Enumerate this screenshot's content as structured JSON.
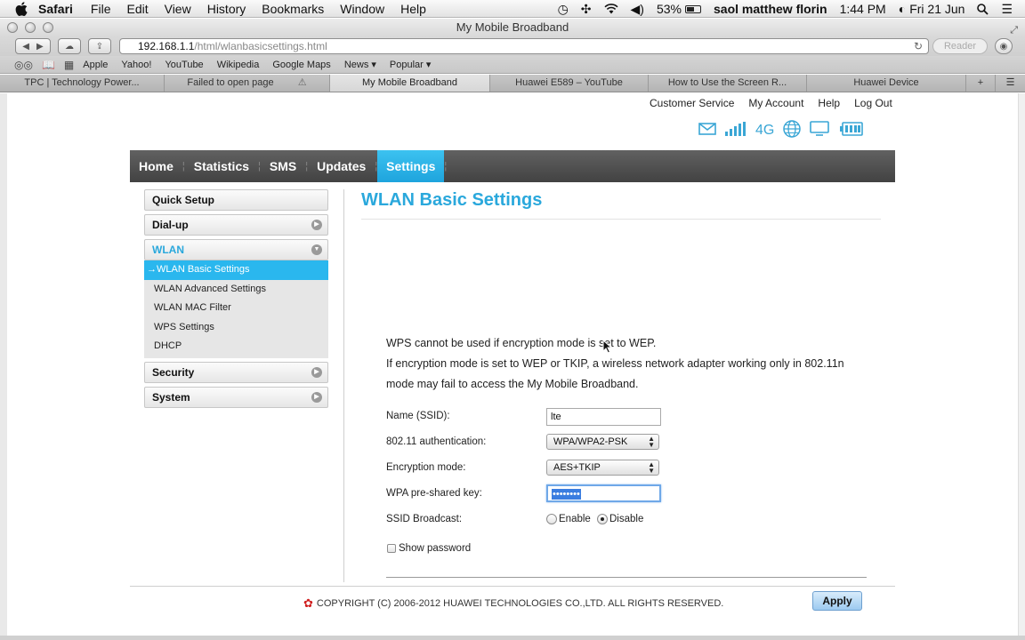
{
  "menubar": {
    "app": "Safari",
    "items": [
      "File",
      "Edit",
      "View",
      "History",
      "Bookmarks",
      "Window",
      "Help"
    ],
    "battery": "53%",
    "user": "saol matthew florin",
    "time": "1:44 PM",
    "date": "Fri 21 Jun"
  },
  "window": {
    "title": "My Mobile Broadband"
  },
  "toolbar": {
    "url_host": "192.168.1.1",
    "url_path": "/html/wlanbasicsettings.html",
    "reader": "Reader"
  },
  "bookmarks": [
    "Apple",
    "Yahoo!",
    "YouTube",
    "Wikipedia",
    "Google Maps",
    "News ▾",
    "Popular ▾"
  ],
  "tabs": [
    {
      "label": "TPC | Technology Power..."
    },
    {
      "label": "Failed to open page"
    },
    {
      "label": "My Mobile Broadband"
    },
    {
      "label": "Huawei E589 – YouTube"
    },
    {
      "label": "How to Use the Screen R..."
    },
    {
      "label": "Huawei Device"
    }
  ],
  "top_links": [
    "Customer Service",
    "My Account",
    "Help",
    "Log Out"
  ],
  "network_type": "4G",
  "nav": [
    "Home",
    "Statistics",
    "SMS",
    "Updates",
    "Settings"
  ],
  "sidebar": {
    "quick_setup": "Quick Setup",
    "dialup": "Dial-up",
    "wlan": "WLAN",
    "wlan_items": [
      "→WLAN Basic Settings",
      "WLAN Advanced Settings",
      "WLAN MAC Filter",
      "WPS Settings",
      "DHCP"
    ],
    "security": "Security",
    "system": "System"
  },
  "main": {
    "title": "WLAN Basic Settings",
    "info1": "WPS cannot be used if encryption mode is set to WEP.",
    "info2": "If encryption mode is set to WEP or TKIP, a wireless network adapter working only in 802.11n",
    "info3": "mode may fail to access the My Mobile Broadband.",
    "ssid_label": "Name (SSID):",
    "ssid_value": "lte",
    "auth_label": "802.11 authentication:",
    "auth_value": "WPA/WPA2-PSK",
    "enc_label": "Encryption mode:",
    "enc_value": "AES+TKIP",
    "key_label": "WPA pre-shared key:",
    "key_value": "••••••••",
    "broadcast_label": "SSID Broadcast:",
    "enable": "Enable",
    "disable": "Disable",
    "show_password": "Show password",
    "apply": "Apply"
  },
  "footer": "COPYRIGHT (C) 2006-2012 HUAWEI TECHNOLOGIES CO.,LTD. ALL RIGHTS RESERVED."
}
